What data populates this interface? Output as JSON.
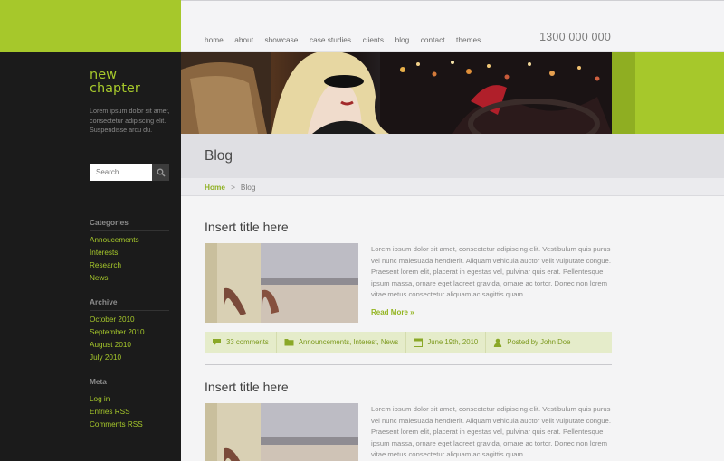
{
  "sidebar": {
    "brand_line1": "new",
    "brand_line2": "chapter",
    "tagline": "Lorem ipsum dolor sit amet, consectetur adipiscing elit. Suspendisse arcu du.",
    "search": {
      "placeholder": "Search"
    },
    "categories": {
      "heading": "Categories",
      "items": [
        "Annoucements",
        "Interests",
        "Research",
        "News"
      ]
    },
    "archive": {
      "heading": "Archive",
      "items": [
        "October 2010",
        "September 2010",
        "August 2010",
        "July 2010"
      ]
    },
    "meta": {
      "heading": "Meta",
      "items": [
        "Log in",
        "Entries RSS",
        "Comments RSS"
      ]
    }
  },
  "nav": {
    "items": [
      "home",
      "about",
      "showcase",
      "case studies",
      "clients",
      "blog",
      "contact",
      "themes"
    ],
    "phone": "1300 000 000"
  },
  "page": {
    "title": "Blog"
  },
  "breadcrumb": {
    "home": "Home",
    "separator": ">",
    "current": "Blog"
  },
  "posts": [
    {
      "title": "Insert title here",
      "excerpt": "Lorem ipsum dolor sit amet, consectetur adipiscing elit. Vestibulum quis purus vel nunc malesuada hendrerit. Aliquam vehicula auctor velit vulputate congue. Praesent lorem elit, placerat in egestas vel, pulvinar quis erat. Pellentesque ipsum massa, ornare eget laoreet gravida, ornare ac tortor. Donec non lorem vitae metus consectetur aliquam ac sagittis quam.",
      "read_more": "Read More »",
      "comments": "33 comments",
      "categories": "Announcements, Interest, News",
      "date": "June 19th, 2010",
      "author": "Posted by John Doe"
    },
    {
      "title": "Insert title here",
      "excerpt": "Lorem ipsum dolor sit amet, consectetur adipiscing elit. Vestibulum quis purus vel nunc malesuada hendrerit. Aliquam vehicula auctor velit vulputate congue. Praesent lorem elit, placerat in egestas vel, pulvinar quis erat. Pellentesque ipsum massa, ornare eget laoreet gravida, ornare ac tortor. Donec non lorem vitae metus consectetur aliquam ac sagittis quam."
    }
  ],
  "colors": {
    "accent": "#a6c82b",
    "sidebar_bg": "#1b1b1b",
    "meta_bar": "#e5ecca"
  },
  "icons": [
    "search-icon",
    "comment-icon",
    "folder-icon",
    "calendar-icon",
    "user-icon"
  ]
}
